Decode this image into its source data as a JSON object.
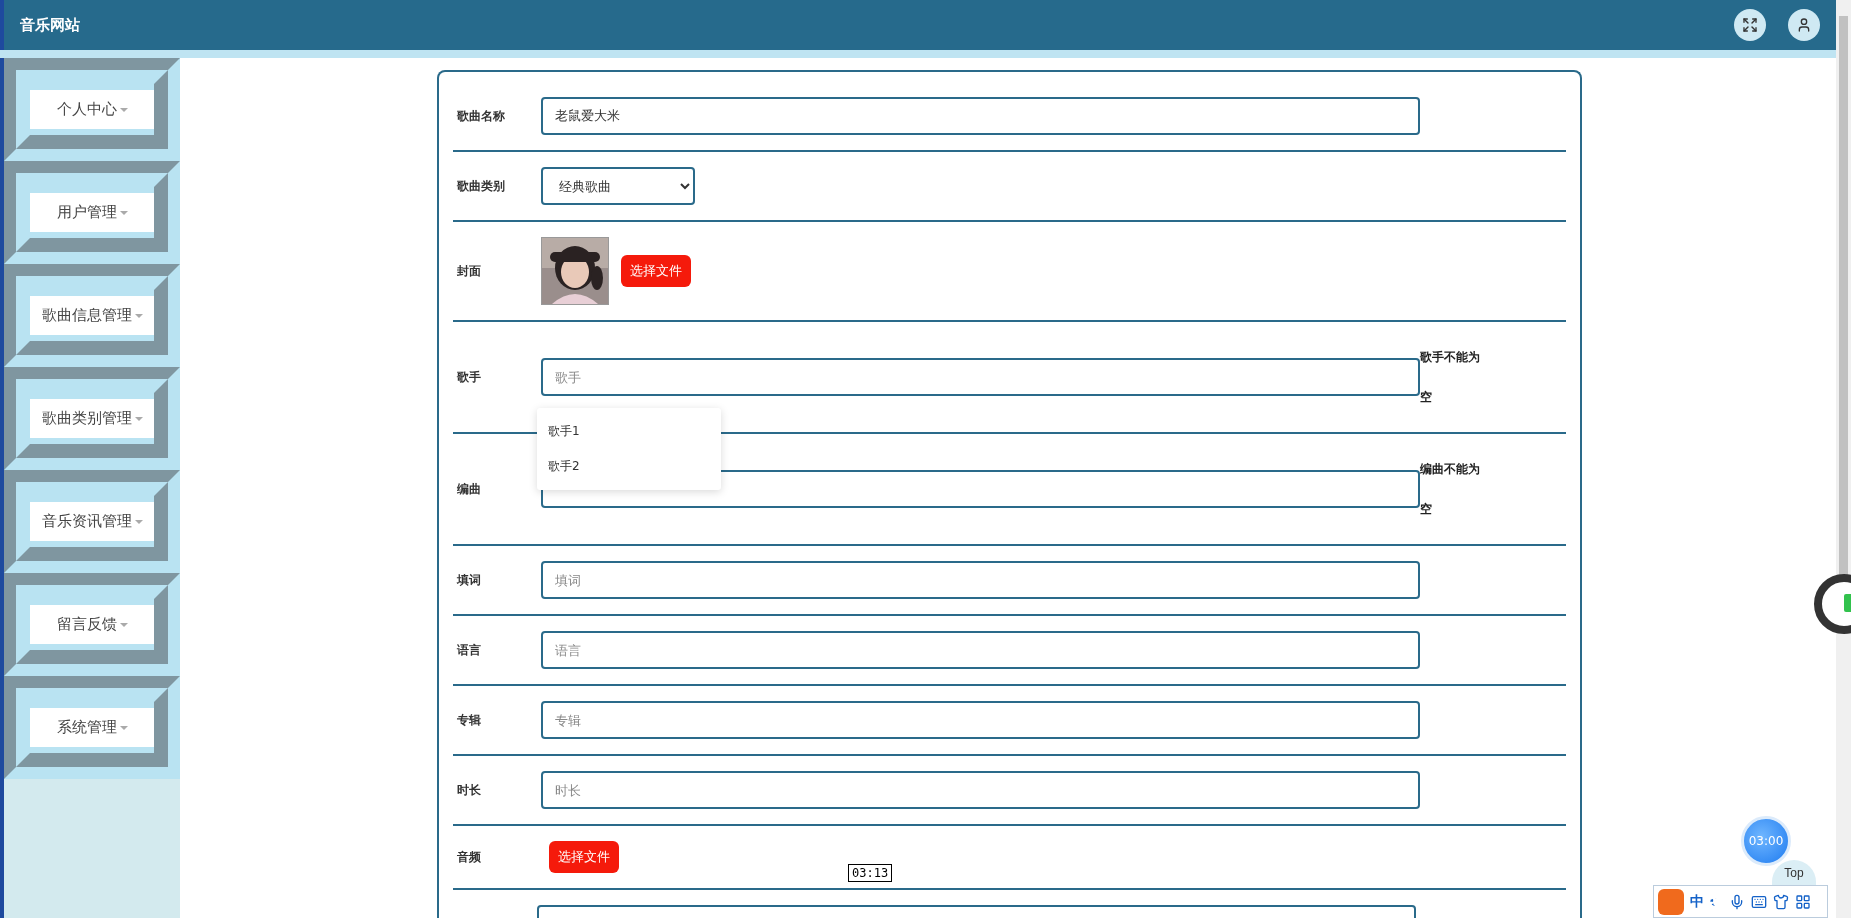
{
  "header": {
    "title": "音乐网站"
  },
  "sidebar": {
    "items": [
      {
        "label": "个人中心"
      },
      {
        "label": "用户管理"
      },
      {
        "label": "歌曲信息管理"
      },
      {
        "label": "歌曲类别管理"
      },
      {
        "label": "音乐资讯管理"
      },
      {
        "label": "留言反馈"
      },
      {
        "label": "系统管理"
      }
    ]
  },
  "form": {
    "rows": [
      {
        "kind": "text",
        "label": "歌曲名称",
        "value": "老鼠爱大米"
      },
      {
        "kind": "select",
        "label": "歌曲类别",
        "value": "经典歌曲"
      },
      {
        "label": "封面",
        "button": "选择文件"
      },
      {
        "kind": "text",
        "label": "歌手",
        "placeholder": "歌手",
        "error": "歌手不能为空",
        "suggestions": [
          "歌手1",
          "歌手2"
        ]
      },
      {
        "kind": "text",
        "label": "编曲",
        "error": "编曲不能为空"
      },
      {
        "kind": "text",
        "label": "填词",
        "placeholder": "填词"
      },
      {
        "kind": "text",
        "label": "语言",
        "placeholder": "语言"
      },
      {
        "kind": "text",
        "label": "专辑",
        "placeholder": "专辑"
      },
      {
        "kind": "text",
        "label": "时长",
        "placeholder": "时长"
      },
      {
        "kind": "file",
        "label": "音频",
        "button": "选择文件"
      },
      {
        "kind": "text"
      }
    ]
  },
  "tooltip": "03:13",
  "timer": "03:00",
  "top_button": "Top",
  "ime": {
    "mode": "中"
  }
}
